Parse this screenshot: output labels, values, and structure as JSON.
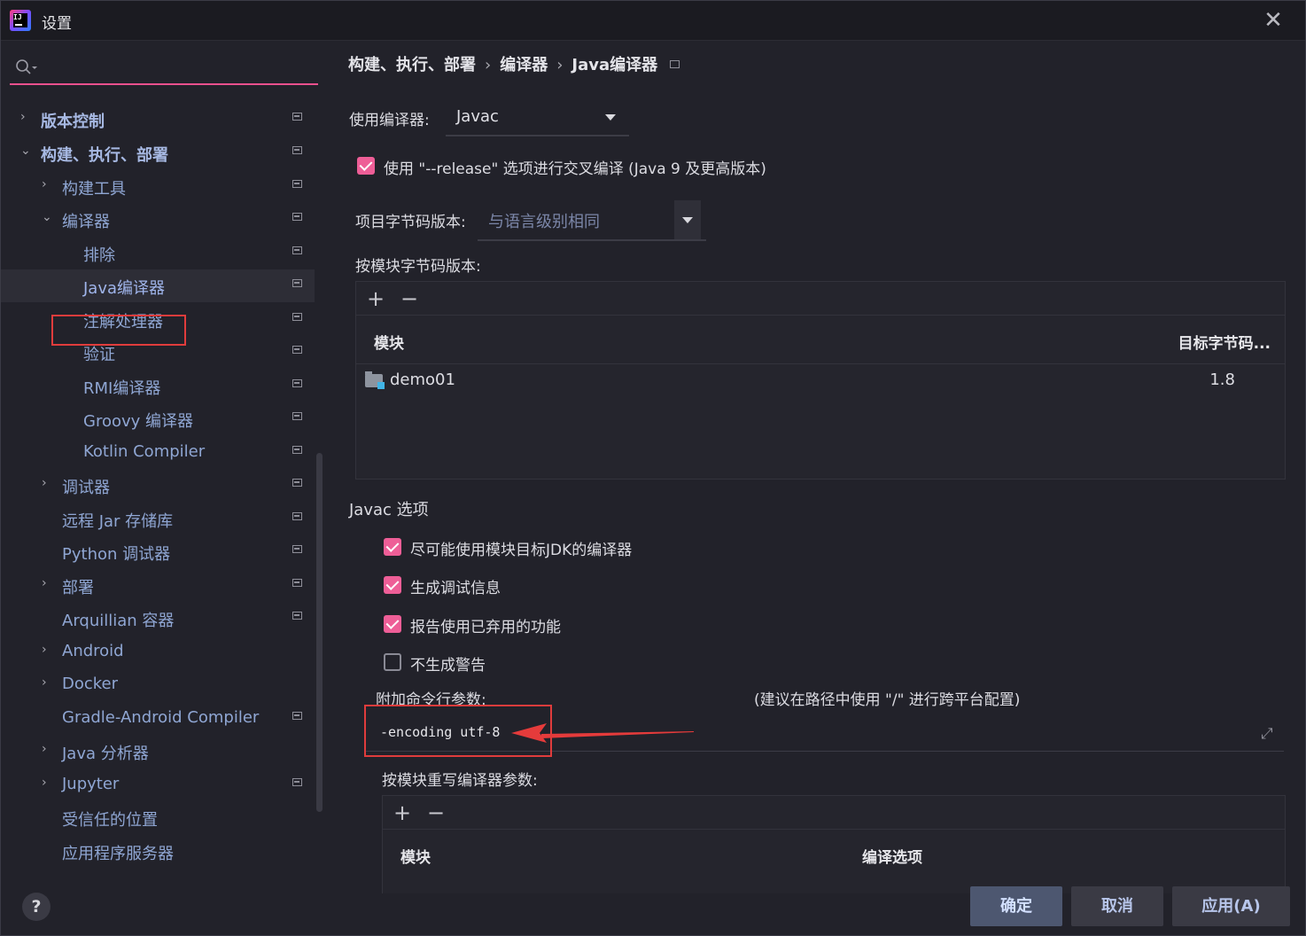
{
  "window": {
    "title": "设置",
    "close_glyph": "✕"
  },
  "search": {
    "placeholder": "",
    "icon": "search-icon"
  },
  "sidebar": {
    "items": [
      {
        "label": "版本控制",
        "arrow": "›",
        "expanded": false
      },
      {
        "label": "构建、执行、部署",
        "arrow": "⌄",
        "expanded": true
      },
      {
        "label": "构建工具",
        "arrow": "›"
      },
      {
        "label": "编译器",
        "arrow": "⌄"
      },
      {
        "label": "排除"
      },
      {
        "label": "Java编译器",
        "selected": true
      },
      {
        "label": "注解处理器"
      },
      {
        "label": "验证"
      },
      {
        "label": "RMI编译器"
      },
      {
        "label": "Groovy 编译器"
      },
      {
        "label": "Kotlin Compiler"
      },
      {
        "label": "调试器",
        "arrow": "›"
      },
      {
        "label": "远程 Jar 存储库"
      },
      {
        "label": "Python 调试器"
      },
      {
        "label": "部署",
        "arrow": "›"
      },
      {
        "label": "Arquillian 容器"
      },
      {
        "label": "Android",
        "arrow": "›"
      },
      {
        "label": "Docker",
        "arrow": "›"
      },
      {
        "label": "Gradle-Android Compiler"
      },
      {
        "label": "Java 分析器",
        "arrow": "›"
      },
      {
        "label": "Jupyter",
        "arrow": "›"
      },
      {
        "label": "受信任的位置"
      },
      {
        "label": "应用程序服务器"
      }
    ]
  },
  "breadcrumb": {
    "part1": "构建、执行、部署",
    "part2": "编译器",
    "part3": "Java编译器",
    "sep": "›"
  },
  "compiler": {
    "label": "使用编译器:",
    "value": "Javac",
    "release_checkbox": "使用 \"--release\" 选项进行交叉编译 (Java 9 及更高版本)",
    "bytecode_label": "项目字节码版本:",
    "bytecode_value": "与语言级别相同",
    "per_module_label": "按模块字节码版本:"
  },
  "module_table": {
    "add": "+",
    "remove": "−",
    "col_module": "模块",
    "col_target": "目标字节码...",
    "rows": [
      {
        "module": "demo01",
        "target": "1.8"
      }
    ]
  },
  "javac": {
    "section": "Javac 选项",
    "opt1": "尽可能使用模块目标JDK的编译器",
    "opt2": "生成调试信息",
    "opt3": "报告使用已弃用的功能",
    "opt4": "不生成警告",
    "args_label": "附加命令行参数:",
    "args_hint": "(建议在路径中使用 \"/\" 进行跨平台配置)",
    "args_value": "-encoding utf-8",
    "override_label": "按模块重写编译器参数:"
  },
  "override_table": {
    "add": "+",
    "remove": "−",
    "col_module": "模块",
    "col_options": "编译选项"
  },
  "footer": {
    "help": "?",
    "ok": "确定",
    "cancel": "取消",
    "apply": "应用(A)"
  }
}
